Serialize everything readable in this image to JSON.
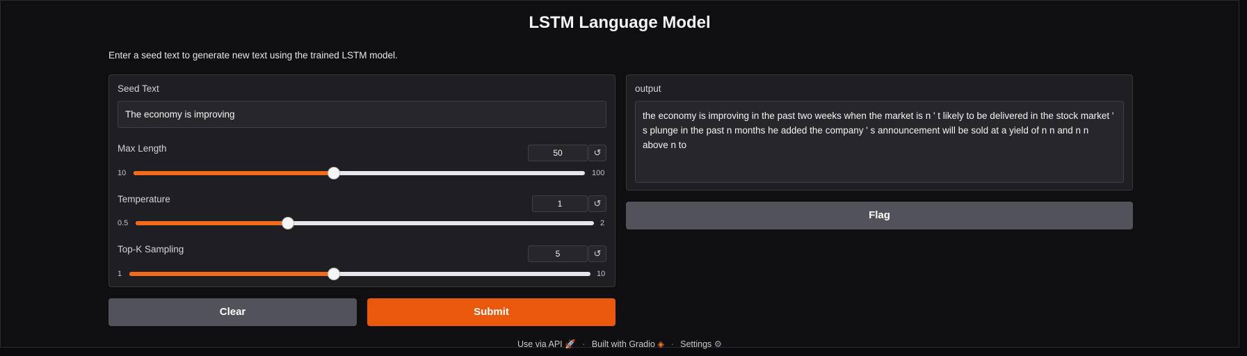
{
  "page": {
    "title": "LSTM Language Model",
    "description": "Enter a seed text to generate new text using the trained LSTM model."
  },
  "inputs": {
    "seed": {
      "label": "Seed Text",
      "value": "The economy is improving"
    },
    "max_length": {
      "label": "Max Length",
      "value": "50",
      "min": "10",
      "max": "100",
      "fraction": 0.444
    },
    "temperature": {
      "label": "Temperature",
      "value": "1",
      "min": "0.5",
      "max": "2",
      "fraction": 0.333
    },
    "top_k": {
      "label": "Top-K Sampling",
      "value": "5",
      "min": "1",
      "max": "10",
      "fraction": 0.444
    },
    "reset_glyph": "↺"
  },
  "output": {
    "label": "output",
    "text": "the economy is improving in the past two weeks when the market is n ' t likely to be delivered in the stock market ' s plunge in the past n months he added the company ' s announcement will be sold at a yield of n n and n n above n to"
  },
  "buttons": {
    "clear": "Clear",
    "submit": "Submit",
    "flag": "Flag"
  },
  "footer": {
    "api": "Use via API",
    "built": "Built with Gradio",
    "settings": "Settings",
    "separator": "·"
  },
  "colors": {
    "accent": "#f26a1b",
    "submit_bg": "#ea580c",
    "secondary_bg": "#52525b",
    "panel_bg": "#1f1f23"
  }
}
